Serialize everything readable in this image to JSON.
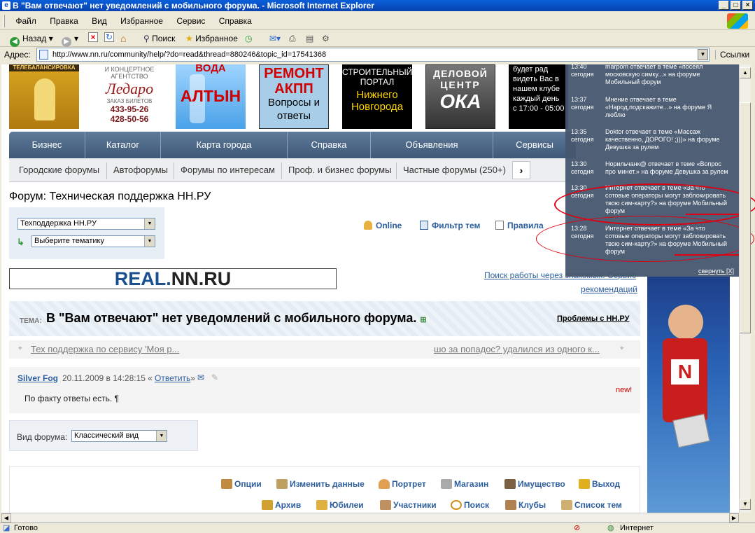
{
  "window": {
    "title": "В \"Вам отвечают\" нет уведомлений с мобильного форума. - Microsoft Internet Explorer"
  },
  "menu": [
    "Файл",
    "Правка",
    "Вид",
    "Избранное",
    "Сервис",
    "Справка"
  ],
  "toolbar": {
    "back": "Назад",
    "search": "Поиск",
    "favorites": "Избранное"
  },
  "address": {
    "label": "Адрес:",
    "url": "http://www.nn.ru/community/help/?do=read&thread=880246&topic_id=17541368",
    "links": "Ссылки"
  },
  "banners": [
    {
      "text": "ТЕЛЕБАЛАНСИРОВКА"
    },
    {
      "line1": "И КОНЦЕРТНОЕ",
      "line2": "АГЕНТСТВО",
      "brand": "Ледаро",
      "sub": "ЗАКАЗ БИЛЕТОВ",
      "phone1": "433-95-26",
      "phone2": "428-50-56"
    },
    {
      "line1": "ВОДА",
      "line2": "АЛТЫН"
    },
    {
      "line1": "РЕМОНТ",
      "line2": "АКПП",
      "line3": "Вопросы и",
      "line4": "ответы"
    },
    {
      "line1": "СТРОИТЕЛЬНЫЙ",
      "line2": "ПОРТАЛ",
      "line3": "Нижнего",
      "line4": "Новгорода"
    },
    {
      "line1": "ДЕЛОВОЙ",
      "line2": "ЦЕНТР",
      "line3": "ОКА"
    },
    {
      "line1": "будет рад",
      "line2": "видеть Вас в",
      "line3": "нашем клубе",
      "line4": "каждый день",
      "line5": "с 17:00 - 05:00"
    }
  ],
  "nav_main": [
    "Бизнес",
    "Каталог",
    "Карта города",
    "Справка",
    "Объявления",
    "Сервисы"
  ],
  "nav_sub": [
    "Городские форумы",
    "Автофорумы",
    "Форумы по интересам",
    "Проф. и бизнес форумы",
    "Частные форумы (250+)"
  ],
  "forum": {
    "title": "Форум: Техническая поддержка НН.РУ"
  },
  "selects": {
    "forum": "Техподдержка НН.РУ",
    "theme": "Выберите тематику"
  },
  "topic_links": [
    "Online",
    "Фильтр тем",
    "Правила"
  ],
  "real": {
    "part1": "REAL.",
    "part2": "NN.RU"
  },
  "jobs": {
    "line1": "Поиск работы через знакомых. Сервис",
    "line2": "рекомендаций"
  },
  "topic": {
    "label": "ТЕМА:",
    "title": "В \"Вам отвечают\" нет уведомлений с мобильного форума.",
    "problems": "Проблемы с НН.РУ",
    "prev": "Тех поддержка по сервису 'Моя р...",
    "next": "шо за попадос? удалился из одного к..."
  },
  "post": {
    "author": "Silver Fog",
    "date": "20.11.2009 в 14:28:15 «",
    "reply": "Ответить",
    "reply_close": "»",
    "body": "По факту ответы есть. ¶",
    "new": "new!"
  },
  "view": {
    "label": "Вид форума:",
    "value": "Классический вид"
  },
  "bottom_row1": [
    "Опции",
    "Изменить данные",
    "Портрет",
    "Магазин",
    "Имущество",
    "Выход"
  ],
  "bottom_row2": [
    "Архив",
    "Юбилеи",
    "Участники",
    "Поиск",
    "Клубы",
    "Список тем"
  ],
  "popup": {
    "items": [
      {
        "time": "13:40",
        "day": "сегодня",
        "l1": "marpom отвечает в теме «посеял",
        "l2": "московскую симку...» на форуме",
        "l3": "Мобильный форум",
        "l4": ""
      },
      {
        "time": "13:37",
        "day": "сегодня",
        "l1": "Мнение отвечает в теме",
        "l2": "«Народ,подскажите...» на форуме Я",
        "l3": "люблю",
        "l4": ""
      },
      {
        "time": "13:35",
        "day": "сегодня",
        "l1": "Doktor отвечает в теме «Массаж",
        "l2": "качественно, ДОРОГО! ;)))» на форуме",
        "l3": "Девушка за рулем",
        "l4": ""
      },
      {
        "time": "13:30",
        "day": "сегодня",
        "l1": "Норильчанк@ отвечает в теме «Вопрос",
        "l2": "про минет.» на форуме Девушка за рулем",
        "l3": "",
        "l4": ""
      },
      {
        "time": "13:30",
        "day": "сегодня",
        "l1": "Интернет отвечает в теме «За что",
        "l2": "сотовые операторы могут заблокировать",
        "l3": "твою сим-карту?» на форуме Мобильный",
        "l4": "форум"
      },
      {
        "time": "13:28",
        "day": "сегодня",
        "l1": "Интернет отвечает в теме «За что",
        "l2": "сотовые операторы могут заблокировать",
        "l3": "твою сим-карту?» на форуме Мобильный",
        "l4": "форум"
      }
    ],
    "collapse": "свернуть [X]"
  },
  "status": {
    "text": "Готово",
    "zone": "Интернет"
  },
  "colors": {
    "nav": "#4b6585",
    "link": "#2c5e9e",
    "popup": "#46566e",
    "annotation": "#e00010"
  }
}
